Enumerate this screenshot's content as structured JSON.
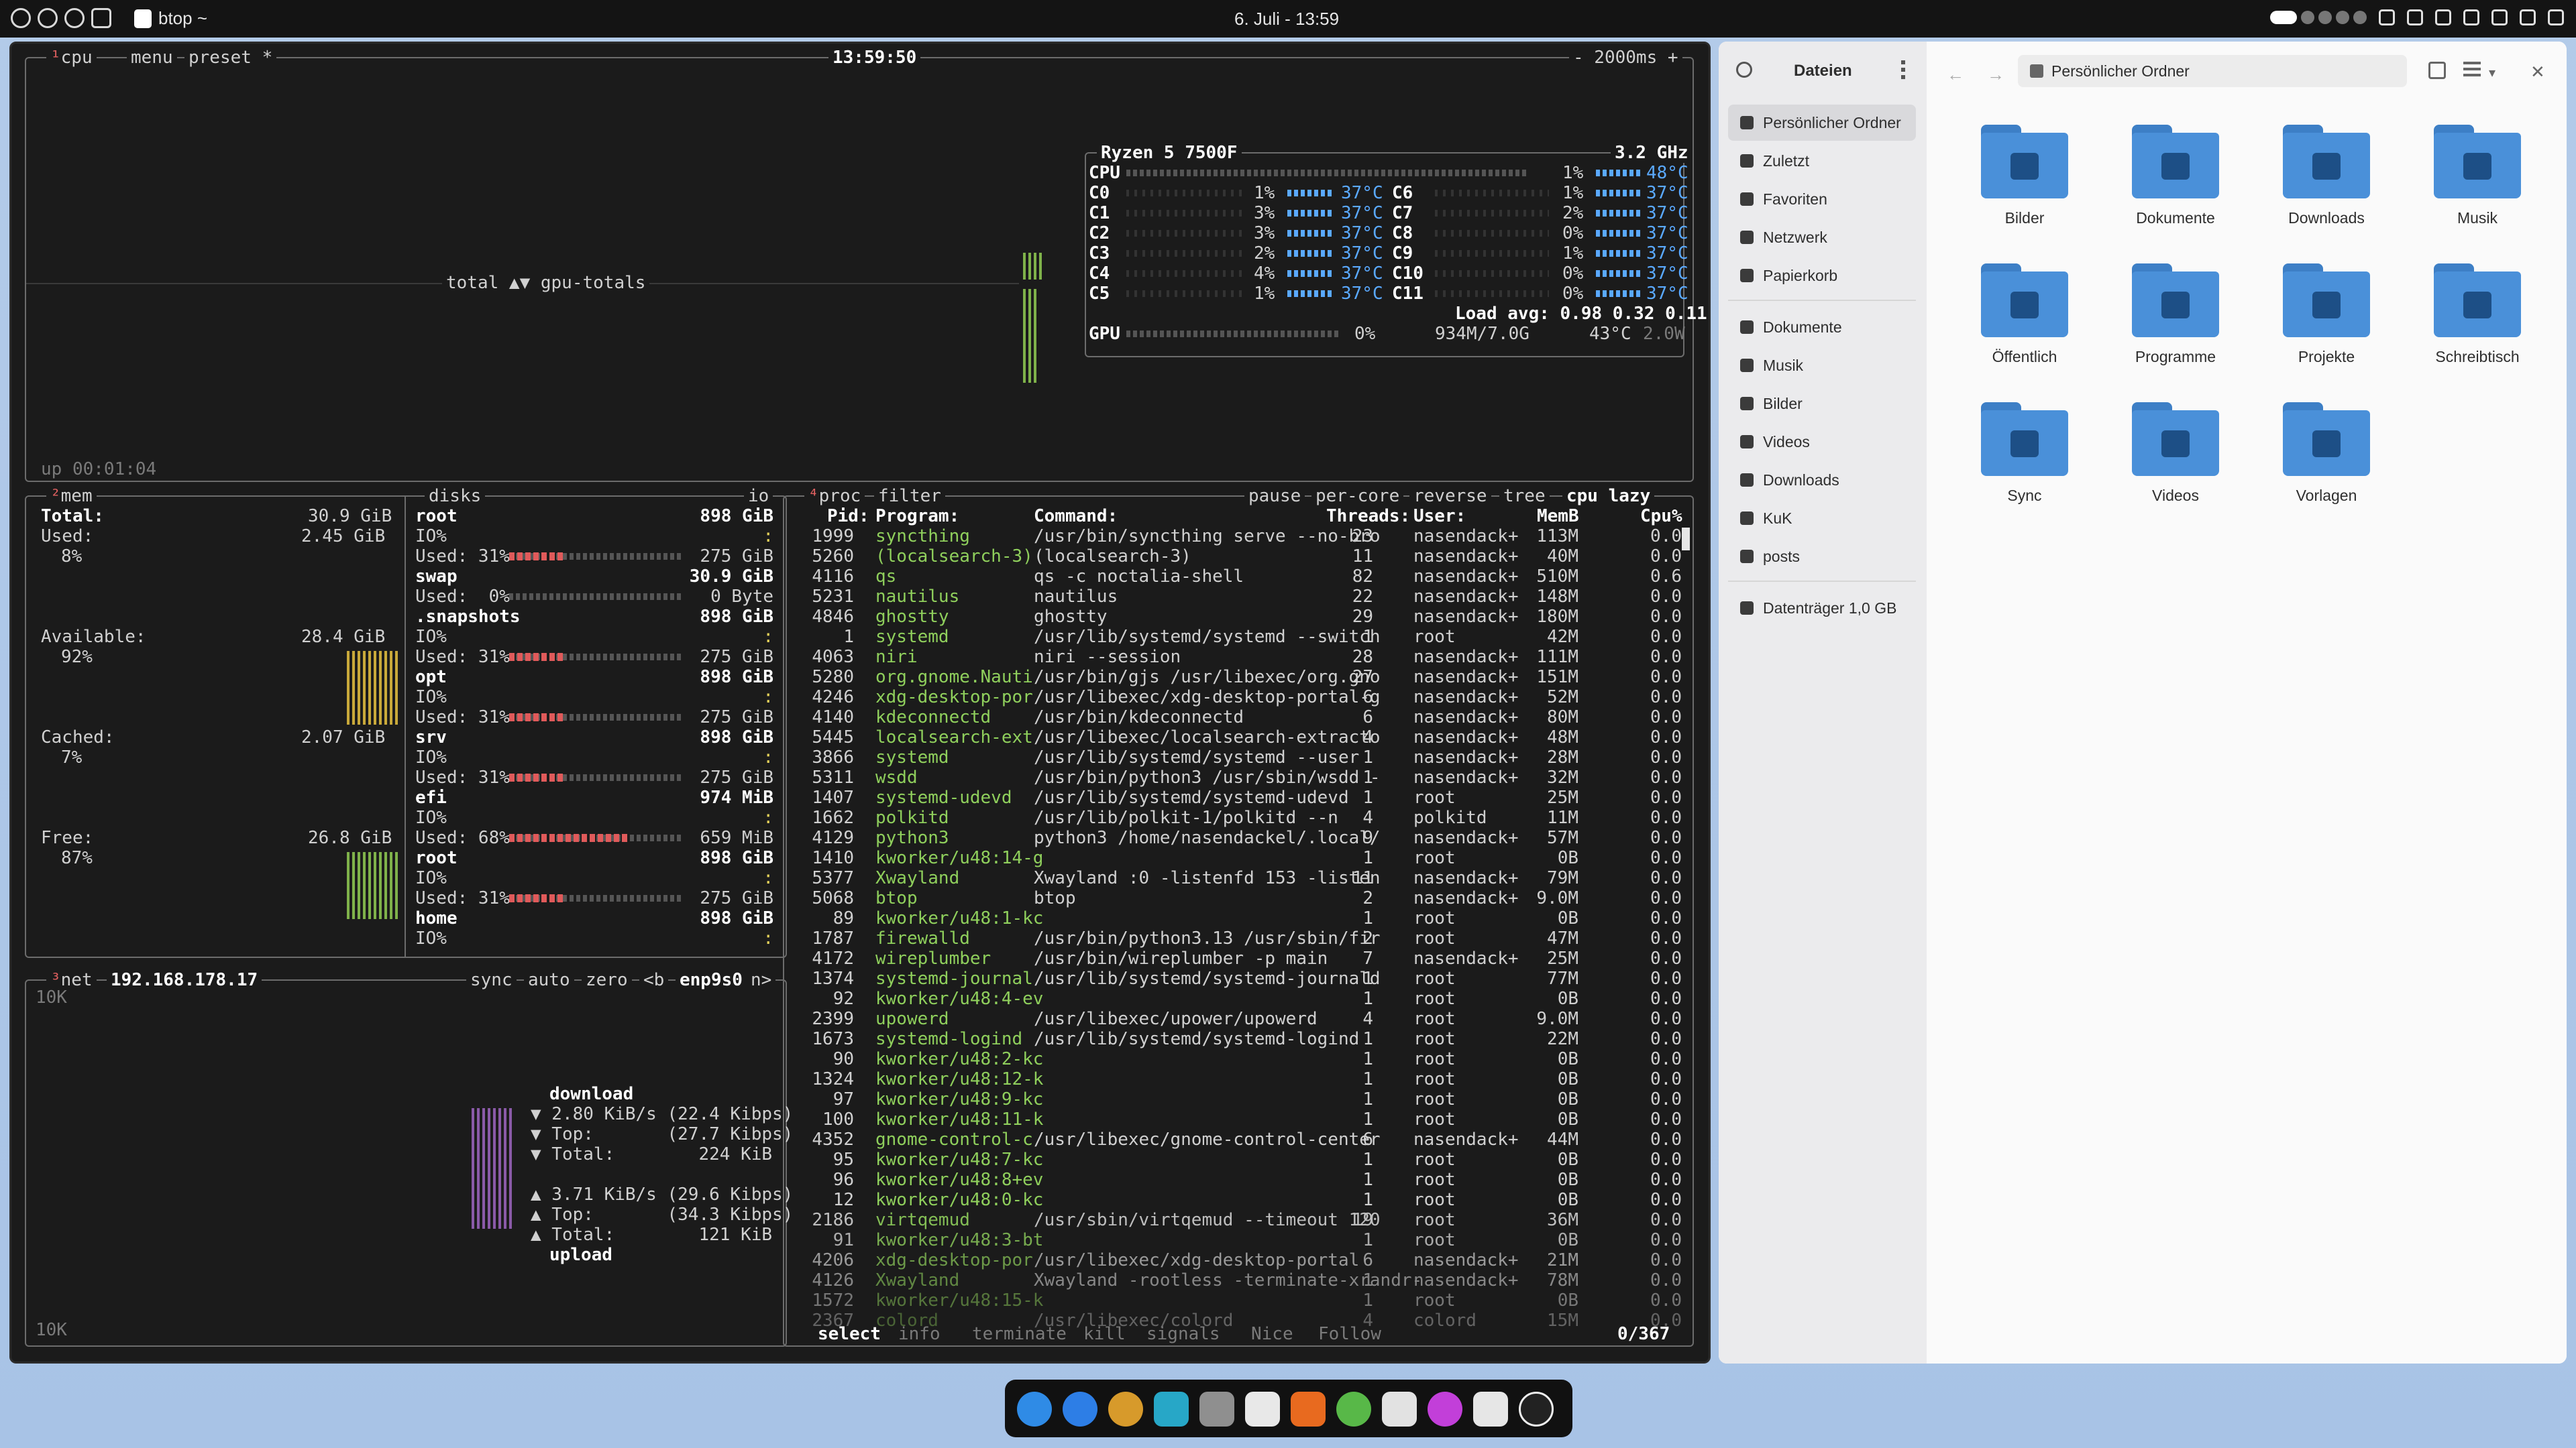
{
  "topbar": {
    "window_title": "btop ~",
    "clock": "6. Juli - 13:59"
  },
  "cpu": {
    "tab": "cpu",
    "menu": "menu",
    "preset": "preset *",
    "time": "13:59:50",
    "interval": "- 2000ms +",
    "graph_label": "total ▲▼ gpu-totals",
    "uptime": "up 00:01:04",
    "model": "Ryzen 5 7500F",
    "freq": "3.2 GHz",
    "total": {
      "name": "CPU",
      "pct": "1%",
      "temp": "48°C"
    },
    "cores": [
      {
        "a": "C0",
        "ap": "1%",
        "at": "37°C",
        "b": "C6",
        "bp": "1%",
        "bt": "37°C"
      },
      {
        "a": "C1",
        "ap": "3%",
        "at": "37°C",
        "b": "C7",
        "bp": "2%",
        "bt": "37°C"
      },
      {
        "a": "C2",
        "ap": "3%",
        "at": "37°C",
        "b": "C8",
        "bp": "0%",
        "bt": "37°C"
      },
      {
        "a": "C3",
        "ap": "2%",
        "at": "37°C",
        "b": "C9",
        "bp": "1%",
        "bt": "37°C"
      },
      {
        "a": "C4",
        "ap": "4%",
        "at": "37°C",
        "b": "C10",
        "bp": "0%",
        "bt": "37°C"
      },
      {
        "a": "C5",
        "ap": "1%",
        "at": "37°C",
        "b": "C11",
        "bp": "0%",
        "bt": "37°C"
      }
    ],
    "load": "Load avg: 0.98 0.32 0.11",
    "gpu": {
      "name": "GPU",
      "pct": "0%",
      "mem": "934M/7.0G",
      "temp": "43°C",
      "power": "2.0W"
    }
  },
  "mem": {
    "tab": "mem",
    "total_l": "Total:",
    "total_v": "30.9 GiB",
    "used_l": "Used:",
    "used_v": "2.45 GiB",
    "used_p": "8%",
    "avail_l": "Available:",
    "avail_v": "28.4 GiB",
    "avail_p": "92%",
    "cached_l": "Cached:",
    "cached_v": "2.07 GiB",
    "cached_p": "7%",
    "free_l": "Free:",
    "free_v": "26.8 GiB",
    "free_p": "87%"
  },
  "disks": {
    "tab": "disks",
    "io": "io",
    "items": [
      {
        "name": "root",
        "size": "898 GiB",
        "io": "IO%",
        "used": "Used: 31%",
        "usedv": "275 GiB",
        "fill": 0.31
      },
      {
        "name": "swap",
        "size": "30.9 GiB",
        "io": "",
        "used": "Used:  0%",
        "usedv": "0 Byte",
        "fill": 0
      },
      {
        "name": ".snapshots",
        "size": "898 GiB",
        "io": "IO%",
        "used": "Used: 31%",
        "usedv": "275 GiB",
        "fill": 0.31
      },
      {
        "name": "opt",
        "size": "898 GiB",
        "io": "IO%",
        "used": "Used: 31%",
        "usedv": "275 GiB",
        "fill": 0.31
      },
      {
        "name": "srv",
        "size": "898 GiB",
        "io": "IO%",
        "used": "Used: 31%",
        "usedv": "275 GiB",
        "fill": 0.31
      },
      {
        "name": "efi",
        "size": "974 MiB",
        "io": "IO%",
        "used": "Used: 68%",
        "usedv": "659 MiB",
        "fill": 0.68
      },
      {
        "name": "root",
        "size": "898 GiB",
        "io": "IO%",
        "used": "Used: 31%",
        "usedv": "275 GiB",
        "fill": 0.31
      },
      {
        "name": "home",
        "size": "898 GiB",
        "io": "IO%",
        "used": "",
        "usedv": "",
        "fill": 0
      }
    ]
  },
  "net": {
    "tab": "net",
    "ip": "192.168.178.17",
    "sync": "sync",
    "auto": "auto",
    "zero": "zero",
    "b": "<b",
    "iface": "enp9s0",
    "n": "n>",
    "scale_top": "10K",
    "scale_bottom": "10K",
    "download": "download",
    "dl_rate": "▼ 2.80 KiB/s (22.4 Kibps)",
    "dl_top": "▼ Top:       (27.7 Kibps)",
    "dl_total": "▼ Total:        224 KiB",
    "ul_rate": "▲ 3.71 KiB/s (29.6 Kibps)",
    "ul_top": "▲ Top:       (34.3 Kibps)",
    "ul_total": "▲ Total:        121 KiB",
    "upload": "upload"
  },
  "proc": {
    "tab": "proc",
    "filter": "filter",
    "pause": "pause",
    "percore": "per-core",
    "reverse": "reverse",
    "tree": "tree",
    "sort": "cpu lazy",
    "header": {
      "pid": "Pid:",
      "prog": "Program:",
      "cmd": "Command:",
      "thr": "Threads:",
      "user": "User:",
      "mem": "MemB",
      "cpu": "Cpu%"
    },
    "rows": [
      [
        "1999",
        "syncthing",
        "/usr/bin/syncthing serve --no-bro",
        "23",
        "nasendack+",
        "113M",
        "0.0"
      ],
      [
        "5260",
        "(localsearch-3)",
        "(localsearch-3)",
        "11",
        "nasendack+",
        "40M",
        "0.0"
      ],
      [
        "4116",
        "qs",
        "qs -c noctalia-shell",
        "82",
        "nasendack+",
        "510M",
        "0.6"
      ],
      [
        "5231",
        "nautilus",
        "nautilus",
        "22",
        "nasendack+",
        "148M",
        "0.0"
      ],
      [
        "4846",
        "ghostty",
        "ghostty",
        "29",
        "nasendack+",
        "180M",
        "0.0"
      ],
      [
        "1",
        "systemd",
        "/usr/lib/systemd/systemd --switch",
        "1",
        "root",
        "42M",
        "0.0"
      ],
      [
        "4063",
        "niri",
        "niri --session",
        "28",
        "nasendack+",
        "111M",
        "0.0"
      ],
      [
        "5280",
        "org.gnome.Nauti",
        "/usr/bin/gjs /usr/libexec/org.gno",
        "27",
        "nasendack+",
        "151M",
        "0.0"
      ],
      [
        "4246",
        "xdg-desktop-por",
        "/usr/libexec/xdg-desktop-portal-g",
        "6",
        "nasendack+",
        "52M",
        "0.0"
      ],
      [
        "4140",
        "kdeconnectd",
        "/usr/bin/kdeconnectd",
        "6",
        "nasendack+",
        "80M",
        "0.0"
      ],
      [
        "5445",
        "localsearch-ext",
        "/usr/libexec/localsearch-extracto",
        "4",
        "nasendack+",
        "48M",
        "0.0"
      ],
      [
        "3866",
        "systemd",
        "/usr/lib/systemd/systemd --user",
        "1",
        "nasendack+",
        "28M",
        "0.0"
      ],
      [
        "5311",
        "wsdd",
        "/usr/bin/python3 /usr/sbin/wsdd -",
        "1",
        "nasendack+",
        "32M",
        "0.0"
      ],
      [
        "1407",
        "systemd-udevd",
        "/usr/lib/systemd/systemd-udevd",
        "1",
        "root",
        "25M",
        "0.0"
      ],
      [
        "1662",
        "polkitd",
        "/usr/lib/polkit-1/polkitd --n",
        "4",
        "polkitd",
        "11M",
        "0.0"
      ],
      [
        "4129",
        "python3",
        "python3 /home/nasendackel/.local/",
        "9",
        "nasendack+",
        "57M",
        "0.0"
      ],
      [
        "1410",
        "kworker/u48:14-g",
        "",
        "1",
        "root",
        "0B",
        "0.0"
      ],
      [
        "5377",
        "Xwayland",
        "Xwayland :0 -listenfd 153 -listen",
        "11",
        "nasendack+",
        "79M",
        "0.0"
      ],
      [
        "5068",
        "btop",
        "btop",
        "2",
        "nasendack+",
        "9.0M",
        "0.0"
      ],
      [
        "89",
        "kworker/u48:1-kc",
        "",
        "1",
        "root",
        "0B",
        "0.0"
      ],
      [
        "1787",
        "firewalld",
        "/usr/bin/python3.13 /usr/sbin/fir",
        "2",
        "root",
        "47M",
        "0.0"
      ],
      [
        "4172",
        "wireplumber",
        "/usr/bin/wireplumber -p main",
        "7",
        "nasendack+",
        "25M",
        "0.0"
      ],
      [
        "1374",
        "systemd-journal",
        "/usr/lib/systemd/systemd-journald",
        "1",
        "root",
        "77M",
        "0.0"
      ],
      [
        "92",
        "kworker/u48:4-ev",
        "",
        "1",
        "root",
        "0B",
        "0.0"
      ],
      [
        "2399",
        "upowerd",
        "/usr/libexec/upower/upowerd",
        "4",
        "root",
        "9.0M",
        "0.0"
      ],
      [
        "1673",
        "systemd-logind",
        "/usr/lib/systemd/systemd-logind",
        "1",
        "root",
        "22M",
        "0.0"
      ],
      [
        "90",
        "kworker/u48:2-kc",
        "",
        "1",
        "root",
        "0B",
        "0.0"
      ],
      [
        "1324",
        "kworker/u48:12-k",
        "",
        "1",
        "root",
        "0B",
        "0.0"
      ],
      [
        "97",
        "kworker/u48:9-kc",
        "",
        "1",
        "root",
        "0B",
        "0.0"
      ],
      [
        "100",
        "kworker/u48:11-k",
        "",
        "1",
        "root",
        "0B",
        "0.0"
      ],
      [
        "4352",
        "gnome-control-c",
        "/usr/libexec/gnome-control-center",
        "6",
        "nasendack+",
        "44M",
        "0.0"
      ],
      [
        "95",
        "kworker/u48:7-kc",
        "",
        "1",
        "root",
        "0B",
        "0.0"
      ],
      [
        "96",
        "kworker/u48:8+ev",
        "",
        "1",
        "root",
        "0B",
        "0.0"
      ],
      [
        "12",
        "kworker/u48:0-kc",
        "",
        "1",
        "root",
        "0B",
        "0.0"
      ],
      [
        "2186",
        "virtqemud",
        "/usr/sbin/virtqemud --timeout 120",
        "19",
        "root",
        "36M",
        "0.0"
      ],
      [
        "91",
        "kworker/u48:3-bt",
        "",
        "1",
        "root",
        "0B",
        "0.0"
      ],
      [
        "4206",
        "xdg-desktop-por",
        "/usr/libexec/xdg-desktop-portal",
        "6",
        "nasendack+",
        "21M",
        "0.0"
      ],
      [
        "4126",
        "Xwayland",
        "Xwayland -rootless -terminate-xrandr-",
        "1",
        "nasendack+",
        "78M",
        "0.0"
      ],
      [
        "1572",
        "kworker/u48:15-k",
        "",
        "1",
        "root",
        "0B",
        "0.0"
      ],
      [
        "2367",
        "colord",
        "/usr/libexec/colord",
        "4",
        "colord",
        "15M",
        "0.0"
      ]
    ],
    "footer": {
      "select": "select",
      "info": "info",
      "terminate": "terminate",
      "kill": "kill",
      "signals": "signals",
      "nice": "Nice",
      "follow": "Follow",
      "count": "0/367"
    }
  },
  "files": {
    "sidebar_title": "Dateien",
    "path": "Persönlicher Ordner",
    "places": [
      "Persönlicher Ordner",
      "Zuletzt",
      "Favoriten",
      "Netzwerk",
      "Papierkorb"
    ],
    "bookmarks": [
      "Dokumente",
      "Musik",
      "Bilder",
      "Videos",
      "Downloads",
      "KuK",
      "posts"
    ],
    "devices": [
      "Datenträger 1,0 GB"
    ],
    "folders": [
      "Bilder",
      "Dokumente",
      "Downloads",
      "Musik",
      "Öffentlich",
      "Programme",
      "Projekte",
      "Schreibtisch",
      "Sync",
      "Videos",
      "Vorlagen"
    ]
  },
  "colors": {
    "accent": "#4a90d9",
    "terminal_bg": "#1b1b1b",
    "green": "#8fcf5c",
    "cyan": "#4fc3c7"
  }
}
